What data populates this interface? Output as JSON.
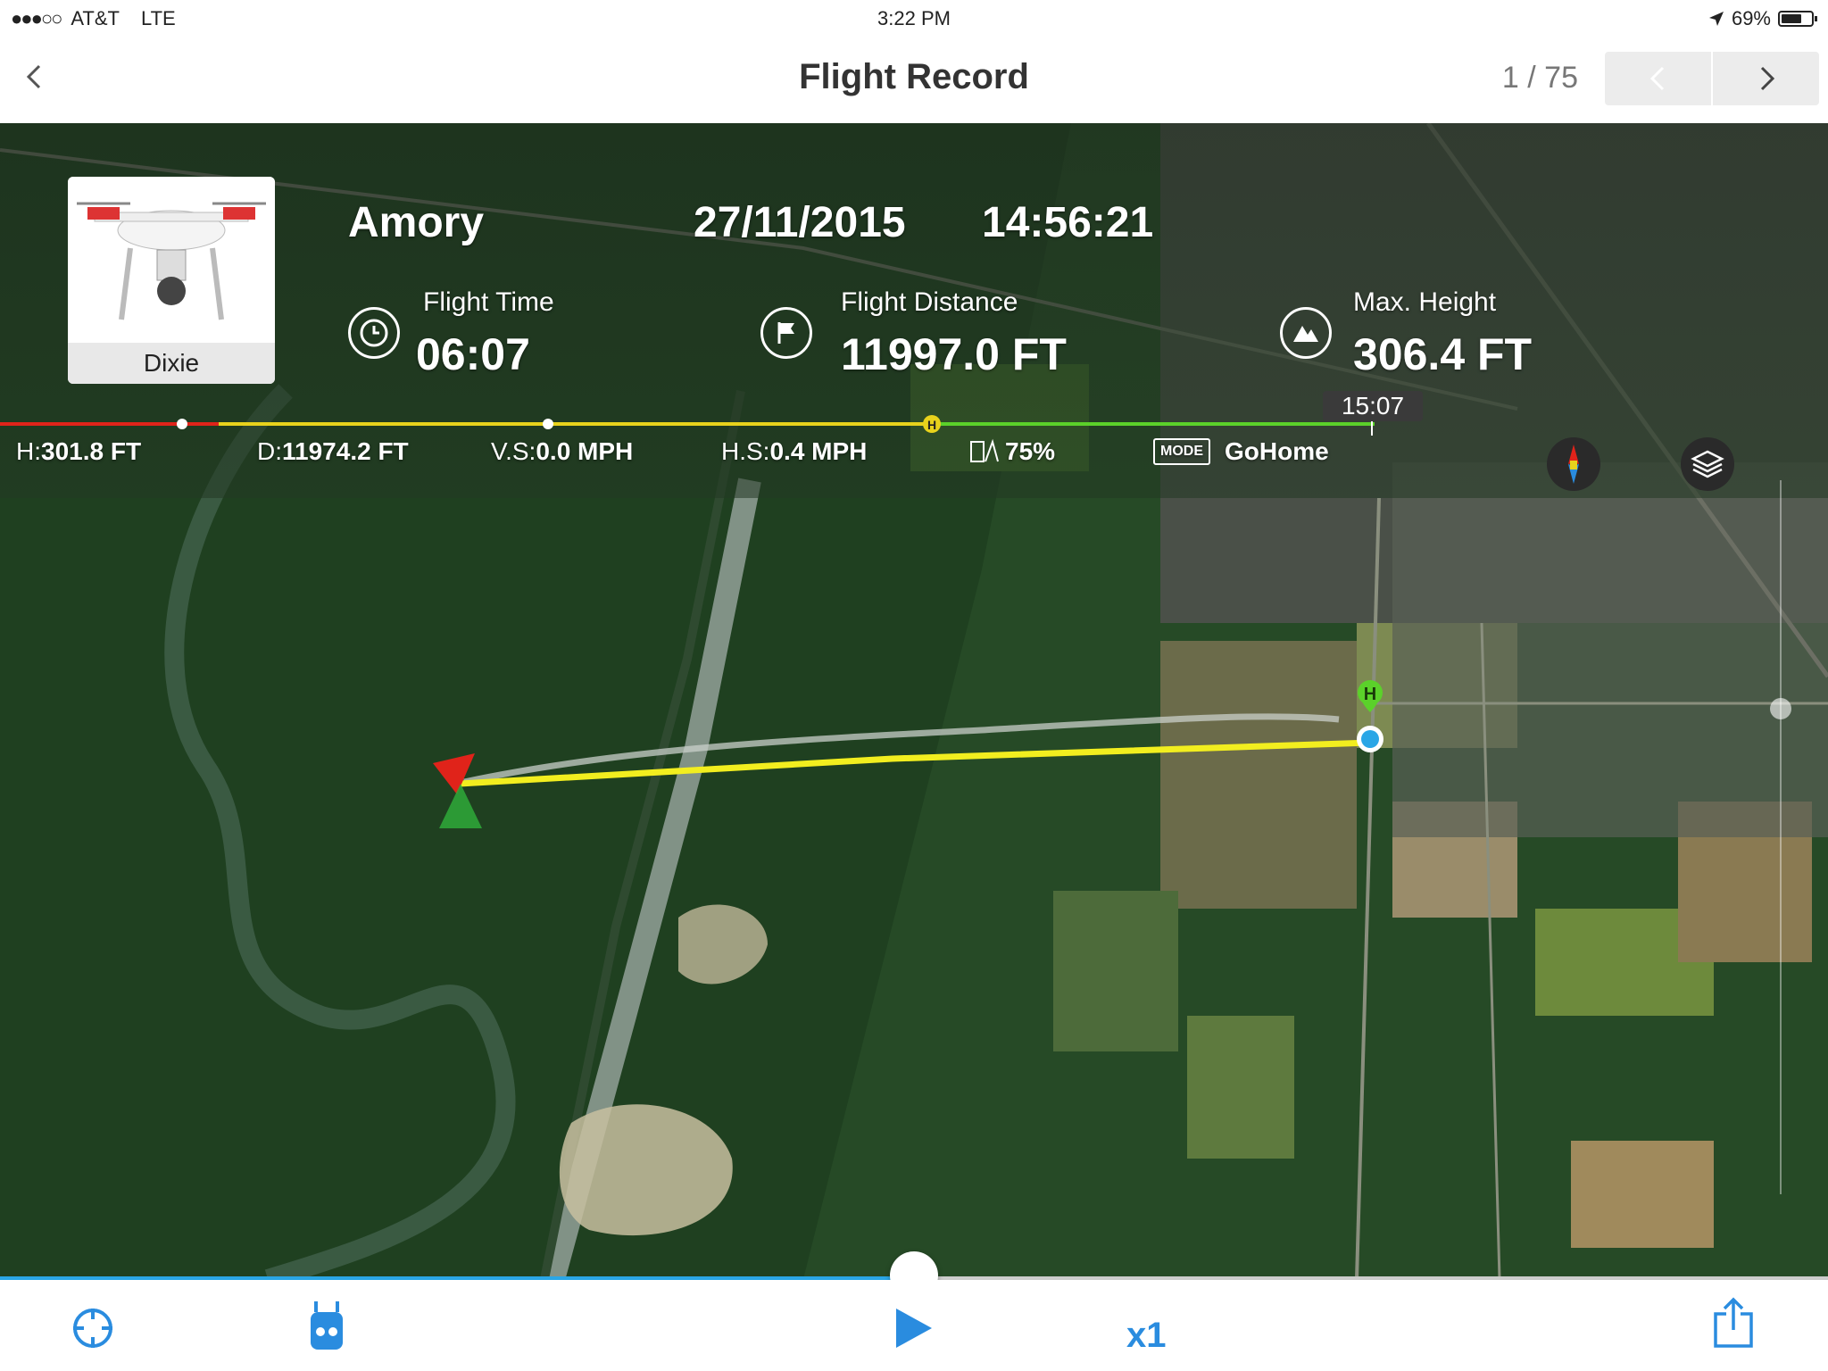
{
  "status_bar": {
    "carrier": "AT&T",
    "network": "LTE",
    "time": "3:22 PM",
    "battery": "69%",
    "battery_level": 0.69
  },
  "nav": {
    "title": "Flight Record",
    "counter": "1 / 75"
  },
  "flight": {
    "drone_name": "Dixie",
    "location": "Amory",
    "date": "27/11/2015",
    "time": "14:56:21",
    "flight_time_label": "Flight Time",
    "flight_time": "06:07",
    "flight_distance_label": "Flight Distance",
    "flight_distance": "11997.0 FT",
    "max_height_label": "Max. Height",
    "max_height": "306.4 FT"
  },
  "timeline": {
    "end_time": "15:07",
    "home_marker": "H"
  },
  "telemetry": {
    "h_label": "H:",
    "h_value": "301.8 FT",
    "d_label": "D:",
    "d_value": "11974.2 FT",
    "vs_label": "V.S:",
    "vs_value": "0.0 MPH",
    "hs_label": "H.S:",
    "hs_value": "0.4 MPH",
    "battery_value": "75%",
    "mode_badge": "MODE",
    "mode_value": "GoHome"
  },
  "map": {
    "home_marker": "H",
    "path_color": "#f2ee1f"
  },
  "playback": {
    "progress": 0.5,
    "speed": "x1"
  },
  "colors": {
    "accent": "#2a8cdf",
    "timeline_red": "#e0231a",
    "timeline_yellow": "#e8d21c",
    "timeline_green": "#5bd12a"
  }
}
